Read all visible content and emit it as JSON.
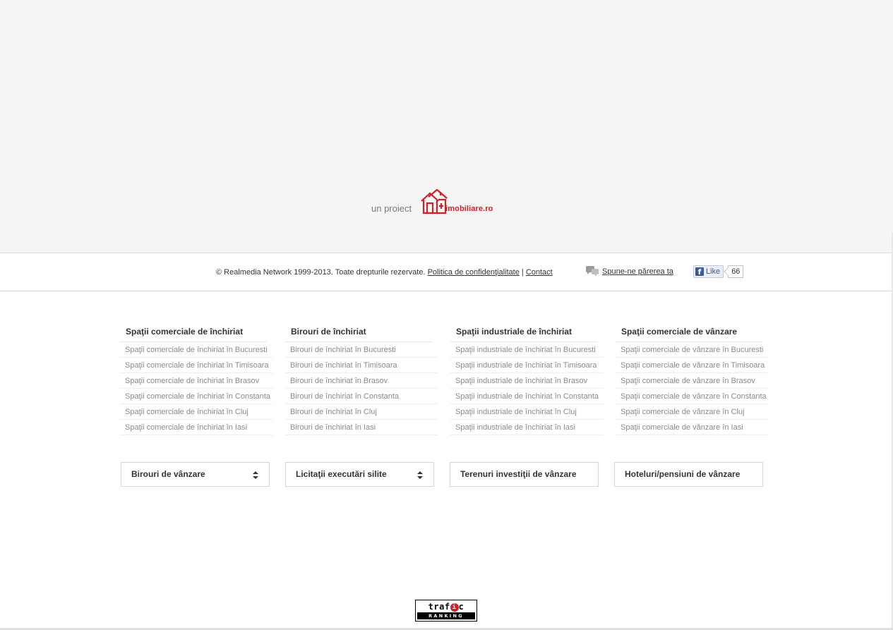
{
  "promo": {
    "label": "un proiect",
    "logo_text": "imobiliare.ro",
    "logo_icon": "house-logo-icon",
    "brand_color": "#d0202a"
  },
  "footer": {
    "copyright": "© Realmedia Network 1999-2013. Toate drepturile rezervate.",
    "privacy_link": "Politica de confidenţialitate",
    "separator": "|",
    "contact_link": "Contact",
    "feedback_icon": "speech-bubbles-icon",
    "feedback_link": "Spune-ne părerea ta",
    "facebook": {
      "like_label": "Like",
      "like_count": "66",
      "icon": "facebook-icon"
    }
  },
  "columns": [
    {
      "title": "Spaţii comerciale de închiriat",
      "items": [
        "Spaţii comerciale de închiriat în Bucuresti",
        "Spaţii comerciale de închiriat în Timisoara",
        "Spaţii comerciale de închiriat în Brasov",
        "Spaţii comerciale de închiriat în Constanta",
        "Spaţii comerciale de închiriat în Cluj",
        "Spaţii comerciale de închiriat în Iasi"
      ]
    },
    {
      "title": "Birouri de închiriat",
      "items": [
        "Birouri de închiriat în Bucuresti",
        "Birouri de închiriat în Timisoara",
        "Birouri de închiriat în Brasov",
        "Birouri de închiriat în Constanta",
        "Birouri de închiriat în Cluj",
        "Birouri de închiriat în Iasi"
      ]
    },
    {
      "title": "Spaţii industriale de închiriat",
      "items": [
        "Spaţii industriale de închiriat în Bucuresti",
        "Spaţii industriale de închiriat în Timisoara",
        "Spaţii industriale de închiriat în Brasov",
        "Spaţii industriale de închiriat în Constanta",
        "Spaţii industriale de închiriat în Cluj",
        "Spaţii industriale de închiriat în Iasi"
      ]
    },
    {
      "title": "Spaţii comerciale de vânzare",
      "items": [
        "Spaţii comerciale de vânzare în Bucuresti",
        "Spaţii comerciale de vânzare în Timisoara",
        "Spaţii comerciale de vânzare în Brasov",
        "Spaţii comerciale de vânzare în Constanta",
        "Spaţii comerciale de vânzare în Cluj",
        "Spaţii comerciale de vânzare în Iasi"
      ]
    }
  ],
  "dropdowns": [
    {
      "label": "Birouri de vânzare",
      "has_arrows": true
    },
    {
      "label": "Licitaţii executări silite",
      "has_arrows": true
    },
    {
      "label": "Terenuri investiţii de vânzare",
      "has_arrows": false
    },
    {
      "label": "Hoteluri/pensiuni de vânzare",
      "has_arrows": false
    }
  ],
  "traffic_badge": {
    "top_prefix": "traf",
    "top_i": "i",
    "top_suffix": "c",
    "bottom": "RANKING"
  }
}
